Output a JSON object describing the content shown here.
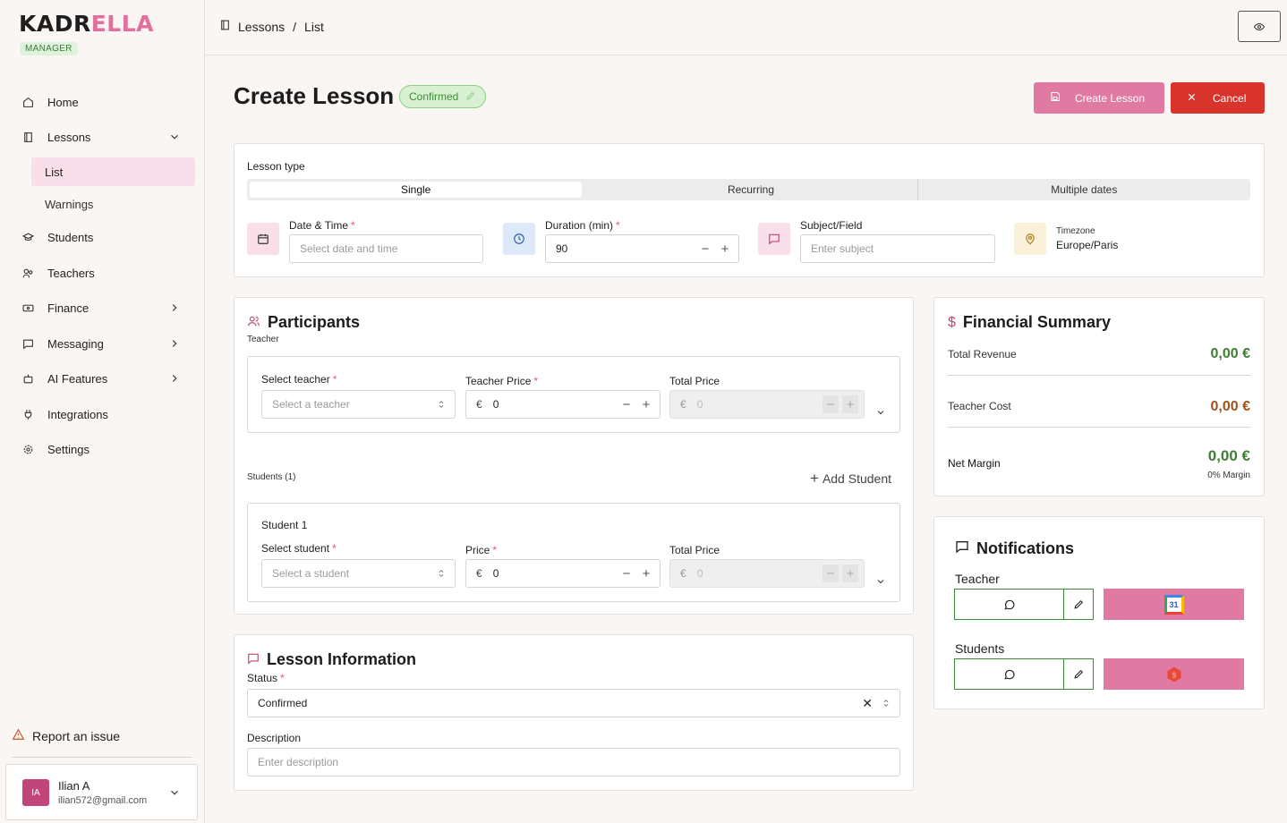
{
  "brand": {
    "logo_part1": "KADR",
    "logo_part2": "ELLA",
    "role": "MANAGER"
  },
  "sidebar": {
    "items": [
      {
        "label": "Home"
      },
      {
        "label": "Lessons"
      },
      {
        "label": "Students"
      },
      {
        "label": "Teachers"
      },
      {
        "label": "Finance"
      },
      {
        "label": "Messaging"
      },
      {
        "label": "AI Features"
      },
      {
        "label": "Integrations"
      },
      {
        "label": "Settings"
      }
    ],
    "lessons_sub": [
      {
        "label": "List"
      },
      {
        "label": "Warnings"
      }
    ],
    "report": "Report an issue",
    "user": {
      "initials": "IA",
      "name": "Ilian A",
      "email": "ilian572@gmail.com"
    }
  },
  "breadcrumb": {
    "part1": "Lessons",
    "sep": "/",
    "part2": "List"
  },
  "header": {
    "title": "Create Lesson",
    "status": "Confirmed",
    "create_label": "Create Lesson",
    "cancel_label": "Cancel"
  },
  "lesson_type": {
    "label": "Lesson type",
    "options": [
      "Single",
      "Recurring",
      "Multiple dates"
    ],
    "date_label": "Date & Time",
    "date_placeholder": "Select date and time",
    "duration_label": "Duration (min)",
    "duration_value": "90",
    "subject_label": "Subject/Field",
    "subject_placeholder": "Enter subject",
    "timezone_label": "Timezone",
    "timezone_value": "Europe/Paris"
  },
  "participants": {
    "title": "Participants",
    "teacher_label": "Teacher",
    "select_teacher_label": "Select teacher",
    "select_teacher_placeholder": "Select a teacher",
    "teacher_price_label": "Teacher Price",
    "teacher_price_value": "0",
    "total_price_label": "Total Price",
    "total_price_value": "0",
    "currency": "€",
    "students_label": "Students (1)",
    "add_student": "Add Student",
    "student_title": "Student 1",
    "select_student_label": "Select student",
    "select_student_placeholder": "Select a student",
    "price_label": "Price",
    "price_value": "0",
    "student_total_label": "Total Price",
    "student_total_value": "0"
  },
  "lesson_info": {
    "title": "Lesson Information",
    "status_label": "Status",
    "status_value": "Confirmed",
    "description_label": "Description",
    "description_placeholder": "Enter description"
  },
  "financial": {
    "title": "Financial Summary",
    "revenue_label": "Total Revenue",
    "revenue_value": "0,00 €",
    "cost_label": "Teacher Cost",
    "cost_value": "0,00 €",
    "margin_label": "Net Margin",
    "margin_value": "0,00 €",
    "margin_pct": "0% Margin",
    "colors": {
      "revenue": "#3f7d34",
      "cost": "#a0521a",
      "margin": "#3f7d34"
    }
  },
  "notifications": {
    "title": "Notifications",
    "teacher_label": "Teacher",
    "students_label": "Students",
    "calendar_day": "31"
  }
}
